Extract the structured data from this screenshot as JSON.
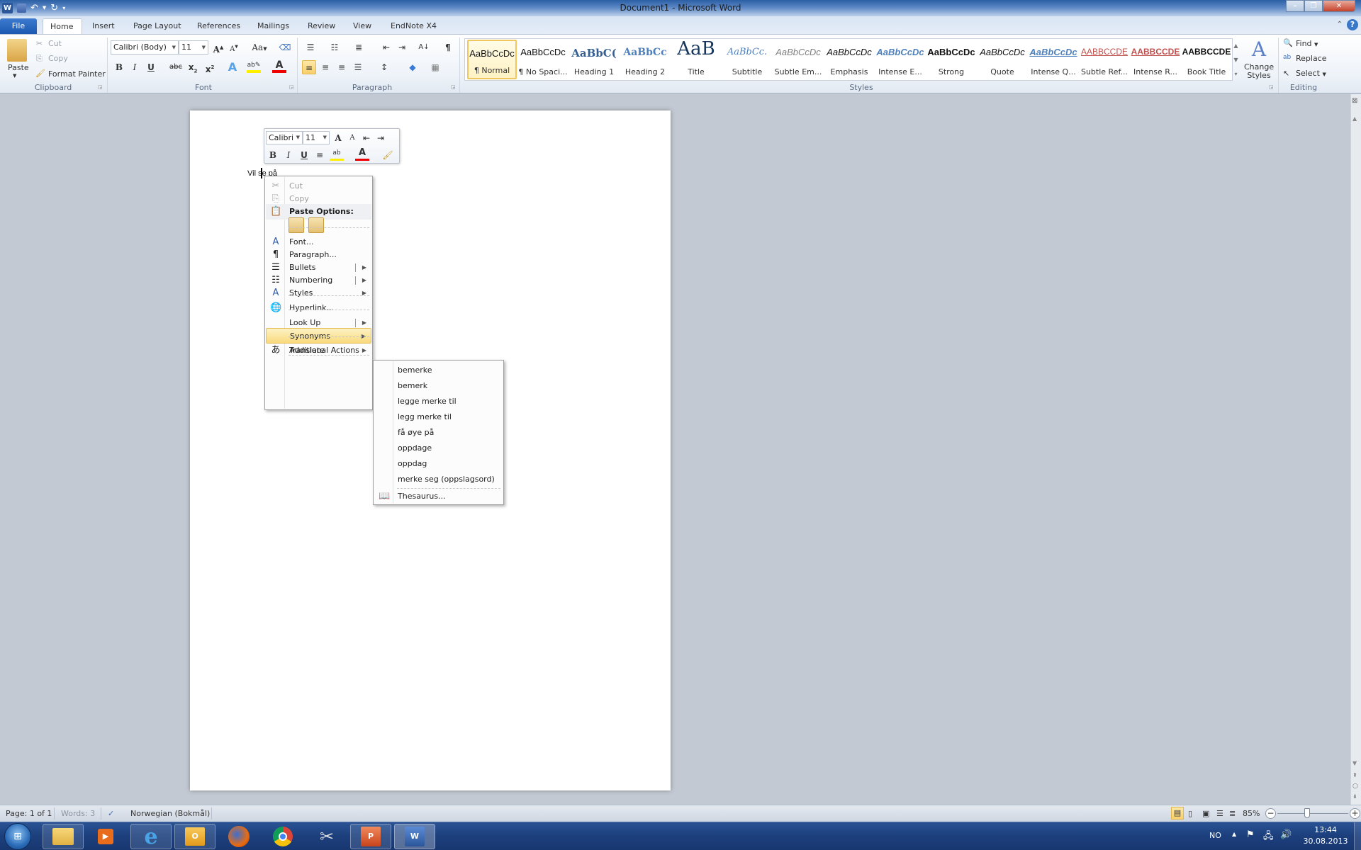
{
  "window": {
    "title": "Document1 - Microsoft Word",
    "controls": {
      "minimize": "–",
      "restore": "❐",
      "close": "✕"
    }
  },
  "quick_access": [
    "word-app-icon",
    "save-icon",
    "undo-icon",
    "redo-icon",
    "customize-icon"
  ],
  "tabs": [
    {
      "label": "File",
      "active": false
    },
    {
      "label": "Home",
      "active": true
    },
    {
      "label": "Insert",
      "active": false
    },
    {
      "label": "Page Layout",
      "active": false
    },
    {
      "label": "References",
      "active": false
    },
    {
      "label": "Mailings",
      "active": false
    },
    {
      "label": "Review",
      "active": false
    },
    {
      "label": "View",
      "active": false
    },
    {
      "label": "EndNote X4",
      "active": false
    }
  ],
  "ribbon": {
    "clipboard": {
      "label": "Clipboard",
      "paste": "Paste",
      "cut": "Cut",
      "copy": "Copy",
      "format_painter": "Format Painter"
    },
    "font": {
      "label": "Font",
      "font_name": "Calibri (Body)",
      "font_size": "11",
      "change_case": "Aa"
    },
    "paragraph": {
      "label": "Paragraph"
    },
    "styles": {
      "label": "Styles",
      "items": [
        {
          "preview": "AaBbCcDc",
          "label": "¶ Normal",
          "selected": true
        },
        {
          "preview": "AaBbCcDc",
          "label": "¶ No Spaci...",
          "selected": false
        },
        {
          "preview": "AaBbC(",
          "label": "Heading 1",
          "selected": false
        },
        {
          "preview": "AaBbCc",
          "label": "Heading 2",
          "selected": false
        },
        {
          "preview": "AaB",
          "label": "Title",
          "selected": false
        },
        {
          "preview": "AaBbCc.",
          "label": "Subtitle",
          "selected": false
        },
        {
          "preview": "AaBbCcDc",
          "label": "Subtle Em...",
          "selected": false
        },
        {
          "preview": "AaBbCcDc",
          "label": "Emphasis",
          "selected": false
        },
        {
          "preview": "AaBbCcDc",
          "label": "Intense E...",
          "selected": false
        },
        {
          "preview": "AaBbCcDc",
          "label": "Strong",
          "selected": false
        },
        {
          "preview": "AaBbCcDc",
          "label": "Quote",
          "selected": false
        },
        {
          "preview": "AaBbCcDc",
          "label": "Intense Q...",
          "selected": false
        },
        {
          "preview": "AABBCCDE",
          "label": "Subtle Ref...",
          "selected": false
        },
        {
          "preview": "AABBCCDE",
          "label": "Intense R...",
          "selected": false
        },
        {
          "preview": "AABBCCDE",
          "label": "Book Title",
          "selected": false
        }
      ],
      "change_styles": "Change Styles"
    },
    "editing": {
      "label": "Editing",
      "find": "Find",
      "replace": "Replace",
      "select": "Select"
    }
  },
  "document": {
    "text": "Vil se på"
  },
  "mini_toolbar": {
    "font_name": "Calibri (E",
    "font_size": "11"
  },
  "context_menu": {
    "items": [
      {
        "label": "Cut",
        "icon": "cut-icon",
        "disabled": true
      },
      {
        "label": "Copy",
        "icon": "copy-icon",
        "disabled": true
      },
      {
        "label": "Paste Options:",
        "icon": "paste-icon",
        "header": true
      },
      {
        "label": "Font...",
        "icon": "font-icon"
      },
      {
        "label": "Paragraph...",
        "icon": "paragraph-icon"
      },
      {
        "label": "Bullets",
        "icon": "bullets-icon",
        "submenu": true,
        "split": true
      },
      {
        "label": "Numbering",
        "icon": "numbering-icon",
        "submenu": true,
        "split": true
      },
      {
        "label": "Styles",
        "icon": "styles-icon",
        "submenu": true
      },
      {
        "label": "Hyperlink...",
        "icon": "hyperlink-icon"
      },
      {
        "label": "Look Up",
        "icon": "",
        "submenu": true,
        "split": true
      },
      {
        "label": "Synonyms",
        "icon": "",
        "submenu": true,
        "highlighted": true
      },
      {
        "label": "Translate",
        "icon": "translate-icon"
      },
      {
        "label": "Additional Actions",
        "icon": "",
        "submenu": true
      }
    ]
  },
  "synonyms_menu": {
    "items": [
      "bemerke",
      "bemerk",
      "legge merke til",
      "legg merke til",
      "få øye på",
      "oppdage",
      "oppdag",
      "merke seg (oppslagsord)"
    ],
    "thesaurus": "Thesaurus..."
  },
  "status_bar": {
    "page": "Page: 1 of 1",
    "words": "Words: 3",
    "language": "Norwegian (Bokmål)",
    "zoom": "85%",
    "zoom_value_percent": 85
  },
  "taskbar": {
    "apps": [
      "windows-explorer",
      "windows-media-player",
      "internet-explorer",
      "outlook",
      "firefox",
      "chrome",
      "snipping-tool",
      "powerpoint",
      "word"
    ],
    "language": "NO",
    "time": "13:44",
    "date": "30.08.2013"
  },
  "colors": {
    "accent": "#2b579a",
    "highlight": "#f9d97c",
    "file_tab": "#1c58b0"
  }
}
